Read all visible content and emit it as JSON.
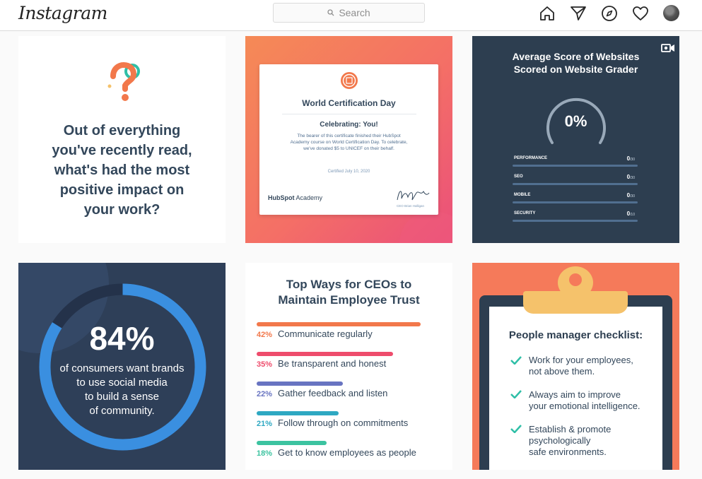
{
  "topbar": {
    "logo": "Instagram",
    "search_placeholder": "Search",
    "nav_icons": [
      "home-icon",
      "direct-icon",
      "explore-icon",
      "activity-heart-icon",
      "profile-avatar"
    ]
  },
  "posts": [
    {
      "type": "question",
      "text_lines": [
        "Out of everything",
        "you've recently read,",
        "what's had the most",
        "positive impact on",
        "your work?"
      ]
    },
    {
      "type": "certificate",
      "title": "World Certification Day",
      "subtitle": "Celebrating: You!",
      "body": "The bearer of this certificate finished their HubSpot Academy course on World Certification Day. To celebrate, we've donated $5 to UNICEF on their behalf.",
      "date": "Certified July 10, 2020",
      "brand_name": "HubSpot",
      "brand_suffix": "Academy",
      "signer": "CEO Brian Halligan"
    },
    {
      "type": "video",
      "title_lines": [
        "Average Score of Websites",
        "Scored on Website Grader"
      ],
      "gauge_value": "0%",
      "metrics": [
        {
          "label": "PERFORMANCE",
          "score": "0",
          "max": "/30"
        },
        {
          "label": "SEO",
          "score": "0",
          "max": "/30"
        },
        {
          "label": "MOBILE",
          "score": "0",
          "max": "/30"
        },
        {
          "label": "SECURITY",
          "score": "0",
          "max": "/10"
        }
      ]
    },
    {
      "type": "stat",
      "value": "84%",
      "progress": 0.84,
      "text_lines": [
        "of consumers want brands",
        "to use social media",
        "to build a sense",
        "of community."
      ]
    },
    {
      "type": "ranking",
      "title_lines": [
        "Top Ways for CEOs to",
        "Maintain Employee Trust"
      ],
      "items": [
        {
          "pct": "42%",
          "label": "Communicate regularly",
          "value": 42,
          "color": "#f2784b"
        },
        {
          "pct": "35%",
          "label": "Be transparent and honest",
          "value": 35,
          "color": "#ee4c6c"
        },
        {
          "pct": "22%",
          "label": "Gather feedback and listen",
          "value": 22,
          "color": "#6874c1"
        },
        {
          "pct": "21%",
          "label": "Follow through on commitments",
          "value": 21,
          "color": "#2ea8c2"
        },
        {
          "pct": "18%",
          "label": "Get to know employees as people",
          "value": 18,
          "color": "#3cc3a0"
        }
      ]
    },
    {
      "type": "checklist",
      "title": "People manager checklist:",
      "items": [
        [
          "Work for your employees,",
          "not above them."
        ],
        [
          "Always aim to improve",
          "your emotional intelligence."
        ],
        [
          "Establish & promote",
          "psychologically",
          "safe environments."
        ]
      ]
    }
  ],
  "colors": {
    "accent_orange": "#f57a5a",
    "navy": "#2d3e50",
    "teal_check": "#2fbfa7"
  }
}
